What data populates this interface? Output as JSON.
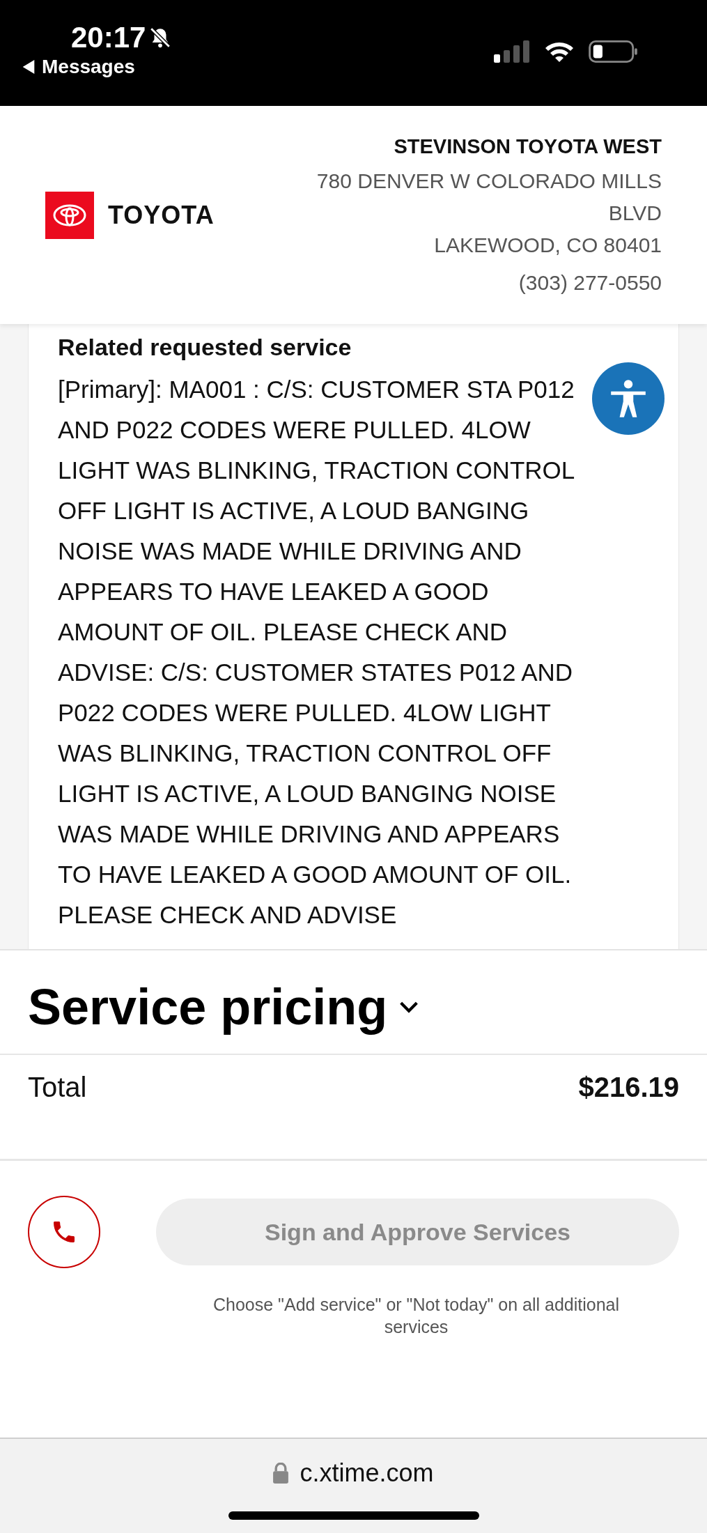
{
  "status_bar": {
    "time": "20:17",
    "back_label": "Messages"
  },
  "header": {
    "brand": "TOYOTA",
    "dealer_name": "STEVINSON TOYOTA WEST",
    "address_lines": [
      "780 DENVER W COLORADO MILLS",
      "BLVD",
      "LAKEWOOD, CO 80401"
    ],
    "phone": "(303) 277-0550"
  },
  "service_card": {
    "heading": "Related requested service",
    "description": "[Primary]: MA001 : C/S: CUSTOMER STA P012 AND P022 CODES WERE PULLED. 4LOW LIGHT WAS BLINKING, TRACTION CONTROL OFF LIGHT IS ACTIVE, A LOUD BANGING NOISE WAS MADE WHILE DRIVING AND APPEARS TO HAVE LEAKED A GOOD AMOUNT OF OIL. PLEASE CHECK AND ADVISE: C/S: CUSTOMER STATES P012 AND P022 CODES WERE PULLED. 4LOW LIGHT WAS BLINKING, TRACTION CONTROL OFF LIGHT IS ACTIVE, A LOUD BANGING NOISE WAS MADE WHILE DRIVING AND APPEARS TO HAVE LEAKED A GOOD AMOUNT OF OIL. PLEASE CHECK AND ADVISE"
  },
  "pricing": {
    "title": "Service pricing",
    "expanded": true,
    "total_label": "Total",
    "total_value": "$216.19"
  },
  "actions": {
    "approve_button": {
      "label": "Sign and Approve Services",
      "disabled": true
    },
    "note": "Choose \"Add service\" or \"Not today\" on all additional services"
  },
  "browser": {
    "url": "c.xtime.com"
  }
}
